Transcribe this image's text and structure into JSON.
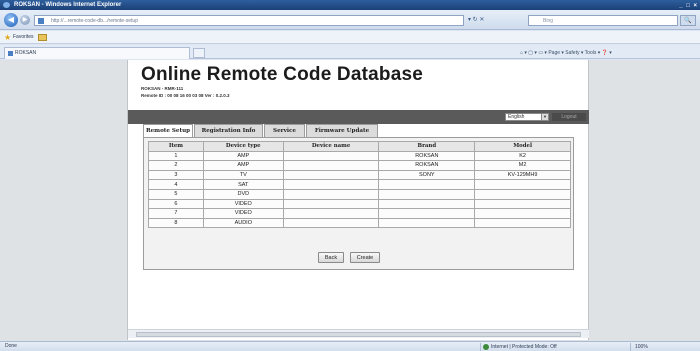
{
  "window": {
    "title": "ROKSAN - Windows Internet Explorer",
    "controls": "_ □ ×"
  },
  "browser": {
    "url": "http://...remote-code-db.../remote-setup",
    "search_placeholder": "Bing",
    "address_icons": "▾ ↻ ✕",
    "search_go": "🔍",
    "favorites_label": "Favorites",
    "tab_label": "ROKSAN",
    "command_bar": "⌂ ▾ ▢ ▾ ▭ ▾ Page ▾ Safety ▾ Tools ▾ ❓ ▾"
  },
  "page": {
    "title": "Online Remote Code Database",
    "subtitle_1": "ROKSAN - RMR-111",
    "subtitle_2": "Remote ID : 00 08 16 00 03 08   Ver : 0.2.0.3",
    "language": "English",
    "logout": "Logout",
    "tabs": [
      {
        "label": "Remote Setup",
        "active": true
      },
      {
        "label": "Registration Info",
        "active": false
      },
      {
        "label": "Service",
        "active": false
      },
      {
        "label": "Firmware Update",
        "active": false
      }
    ],
    "table": {
      "headers": [
        "Item",
        "Device type",
        "Device name",
        "Brand",
        "Model"
      ],
      "rows": [
        [
          "1",
          "AMP",
          "",
          "ROKSAN",
          "K2"
        ],
        [
          "2",
          "AMP",
          "",
          "ROKSAN",
          "M2"
        ],
        [
          "3",
          "TV",
          "",
          "SONY",
          "KV-129MH9"
        ],
        [
          "4",
          "SAT",
          "",
          "",
          ""
        ],
        [
          "5",
          "DVD",
          "",
          "",
          ""
        ],
        [
          "6",
          "VIDEO",
          "",
          "",
          ""
        ],
        [
          "7",
          "VIDEO",
          "",
          "",
          ""
        ],
        [
          "8",
          "AUDIO",
          "",
          "",
          ""
        ]
      ]
    },
    "buttons": {
      "back": "Back",
      "create": "Create"
    }
  },
  "status": {
    "left": "Done",
    "zone": "Internet | Protected Mode: Off",
    "zoom": "100%"
  }
}
